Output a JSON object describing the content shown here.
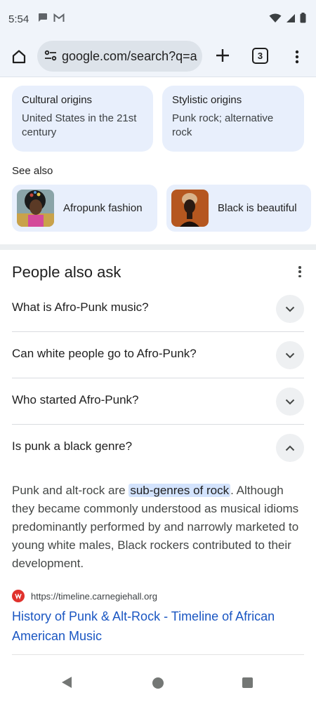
{
  "status_bar": {
    "time": "5:54",
    "left_icons": [
      "chat-bubble-icon",
      "gmail-icon"
    ],
    "right_icons": [
      "wifi-icon",
      "signal-icon",
      "battery-icon"
    ]
  },
  "toolbar": {
    "url": "google.com/search?q=a",
    "tab_count": "3",
    "icons": [
      "home-icon",
      "site-settings-icon",
      "plus-icon",
      "tabs-icon",
      "more-vert-icon"
    ]
  },
  "origins": [
    {
      "title": "Cultural origins",
      "value": "United States in the 21st century"
    },
    {
      "title": "Stylistic origins",
      "value": "Punk rock; alternative rock"
    }
  ],
  "see_also": {
    "label": "See also",
    "items": [
      {
        "label": "Afropunk fashion"
      },
      {
        "label": "Black is beautiful"
      }
    ]
  },
  "paa": {
    "title": "People also ask",
    "questions": [
      {
        "text": "What is Afro-Punk music?",
        "expanded": false
      },
      {
        "text": "Can white people go to Afro-Punk?",
        "expanded": false
      },
      {
        "text": "Who started Afro-Punk?",
        "expanded": false
      },
      {
        "text": "Is punk a black genre?",
        "expanded": true
      }
    ],
    "answer": {
      "before": "Punk and alt-rock are ",
      "highlight": "sub-genres of rock",
      "after": ". Although they became commonly understood as musical idioms predominantly performed by and narrowly marketed to young white males, Black rockers contributed to their development."
    },
    "source": {
      "url": "https://timeline.carnegiehall.org",
      "link_text": "History of Punk & Alt-Rock - Timeline of African American Music"
    }
  },
  "colors": {
    "card_bg": "#e8effc",
    "link": "#1a56c2",
    "highlight": "#d3e3fd",
    "toolbar_bg": "#f0f4fa"
  }
}
